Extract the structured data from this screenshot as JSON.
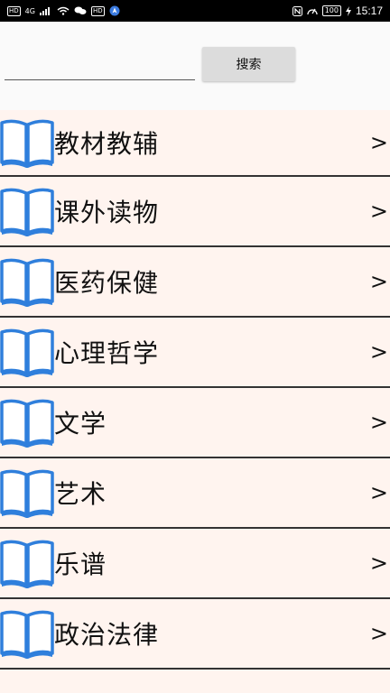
{
  "status_bar": {
    "left_badges": [
      "HD",
      "4G",
      "HD"
    ],
    "time": "15:17",
    "battery": "100"
  },
  "search": {
    "value": "",
    "placeholder": "",
    "button_label": "搜索"
  },
  "categories": [
    {
      "label": "教材教辅",
      "chevron": ">"
    },
    {
      "label": "课外读物",
      "chevron": ">"
    },
    {
      "label": "医药保健",
      "chevron": ">"
    },
    {
      "label": "心理哲学",
      "chevron": ">"
    },
    {
      "label": "文学",
      "chevron": ">"
    },
    {
      "label": "艺术",
      "chevron": ">"
    },
    {
      "label": "乐谱",
      "chevron": ">"
    },
    {
      "label": "政治法律",
      "chevron": ">"
    }
  ],
  "colors": {
    "status_bar_bg": "#000000",
    "list_bg": "#fff4ef",
    "icon_blue": "#2f7fdc",
    "button_bg": "#dcdcdc"
  },
  "icons": {
    "category_icon": "open-book-icon",
    "row_chevron": "chevron-right-icon"
  }
}
